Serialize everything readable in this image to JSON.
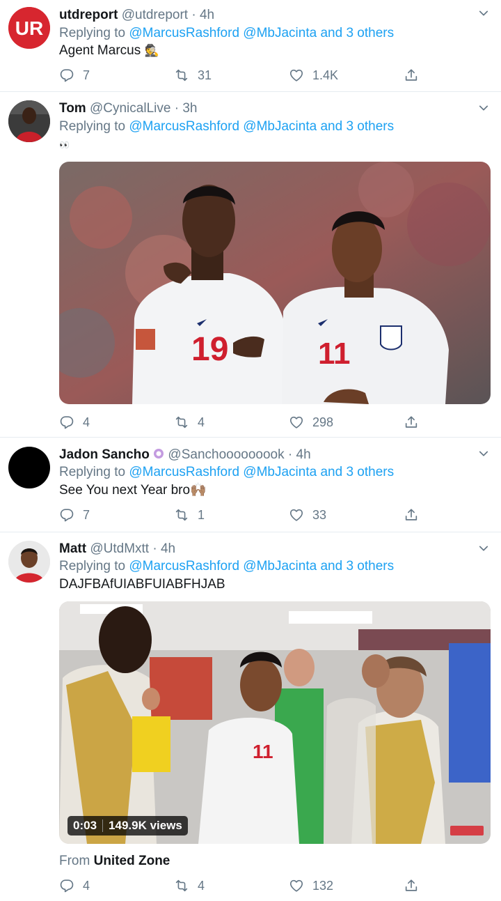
{
  "tweets": [
    {
      "name": "utdreport",
      "handle": "@utdreport",
      "time": "· 4h",
      "replying_prefix": "Replying to",
      "reply_to": "@MarcusRashford @MbJacinta",
      "reply_and": "and",
      "reply_others": "3 others",
      "text": "Agent Marcus",
      "emoji": "🕵",
      "avatar_label": "UR",
      "replies": "7",
      "retweets": "31",
      "likes": "1.4K"
    },
    {
      "name": "Tom",
      "handle": "@CynicalLive",
      "time": "· 3h",
      "replying_prefix": "Replying to",
      "reply_to": "@MarcusRashford @MbJacinta",
      "reply_and": "and",
      "reply_others": "3 others",
      "text": "👀",
      "replies": "4",
      "retweets": "4",
      "likes": "298",
      "jersey_left": "19",
      "jersey_right": "11"
    },
    {
      "name": "Jadon Sancho",
      "handle": "@Sanchooooooook",
      "time": "· 4h",
      "replying_prefix": "Replying to",
      "reply_to": "@MarcusRashford @MbJacinta",
      "reply_and": "and",
      "reply_others": "3 others",
      "text": "See You next Year bro🙌🏽",
      "replies": "7",
      "retweets": "1",
      "likes": "33"
    },
    {
      "name": "Matt",
      "handle": "@UtdMxtt",
      "time": "· 4h",
      "replying_prefix": "Replying to",
      "reply_to": "@MarcusRashford @MbJacinta",
      "reply_and": "and",
      "reply_others": "3 others",
      "text": "DAJFBAfUIABFUIABFHJAB",
      "video_time": "0:03",
      "video_views": "149.9K views",
      "source_prefix": "From",
      "source_name": "United Zone",
      "replies": "4",
      "retweets": "4",
      "likes": "132",
      "jersey": "11"
    }
  ],
  "colors": {
    "link": "#1da1f2",
    "muted": "#657786",
    "text": "#14171a",
    "border": "#e6ecf0",
    "utd_red": "#d7262f"
  },
  "icons": [
    "chevron-down-icon",
    "reply-icon",
    "retweet-icon",
    "like-icon",
    "share-icon",
    "verified-badge-icon"
  ]
}
